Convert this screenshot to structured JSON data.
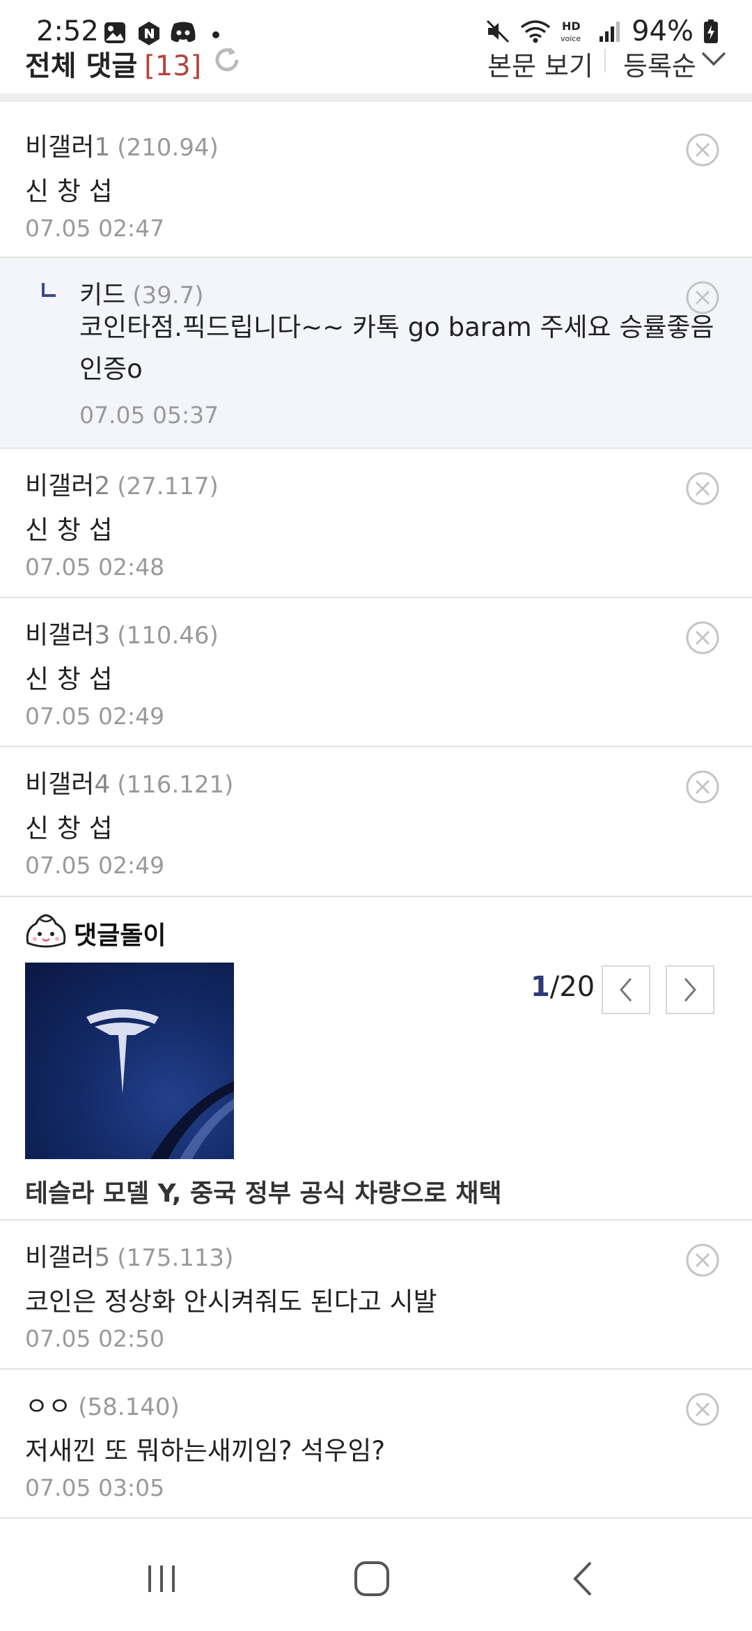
{
  "status_bar": {
    "time": "2:52",
    "battery": "94%",
    "icons": [
      "gallery-icon",
      "naver-icon",
      "discord-icon",
      "dot-icon",
      "mute-icon",
      "wifi-icon",
      "hd-voice-icon",
      "signal-icon",
      "battery-icon"
    ]
  },
  "header": {
    "title": "전체 댓글",
    "count": "[13]",
    "view_body": "본문 보기",
    "sort": "등록순"
  },
  "comments": [
    {
      "name": "비갤러",
      "num": "1",
      "ip": "(210.94)",
      "text": "신 창 섭",
      "date": "07.05 02:47"
    },
    {
      "name": "키드",
      "num": "",
      "ip": "(39.7)",
      "text": "코인타점.픽드립니다~~ 카톡 go baram 주세요 승률좋음인증o",
      "date": "07.05 05:37"
    },
    {
      "name": "비갤러",
      "num": "2",
      "ip": "(27.117)",
      "text": "신 창 섭",
      "date": "07.05 02:48"
    },
    {
      "name": "비갤러",
      "num": "3",
      "ip": "(110.46)",
      "text": "신 창 섭",
      "date": "07.05 02:49"
    },
    {
      "name": "비갤러",
      "num": "4",
      "ip": "(116.121)",
      "text": "신 창 섭",
      "date": "07.05 02:49"
    },
    {
      "name": "비갤러",
      "num": "5",
      "ip": "(175.113)",
      "text": "코인은 정상화 안시켜줘도 된다고 시발",
      "date": "07.05 02:50"
    },
    {
      "name": "ㅇㅇ",
      "num": "",
      "ip": "(58.140)",
      "text": "저새낀 또 뭐하는새끼임? 석우임?",
      "date": "07.05 03:05"
    }
  ],
  "recommend": {
    "title": "댓글돌이",
    "page_current": "1",
    "page_total": "/20",
    "caption": "테슬라 모델 Y, 중국 정부 공식 차량으로 채택"
  },
  "colors": {
    "accent_count": "#b5433b",
    "reply_bg": "#f3f5fa",
    "pager_current": "#2d3a7a"
  }
}
